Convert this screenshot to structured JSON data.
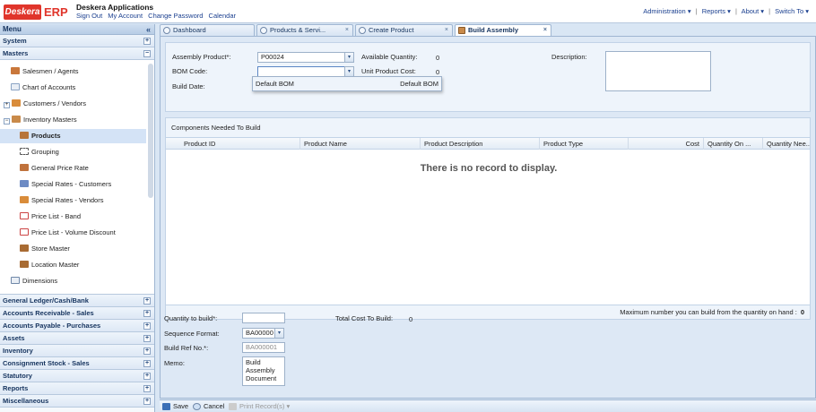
{
  "header": {
    "logo_text": "Deskera",
    "logo_erp": "ERP",
    "app_title": "Deskera Applications",
    "links": [
      "Sign Out",
      "My Account",
      "Change Password",
      "Calendar"
    ],
    "right_menu": [
      "Administration",
      "Reports",
      "About",
      "Switch To"
    ],
    "caret": "▾",
    "separator": "|"
  },
  "sidebar": {
    "title": "Menu",
    "collapse_glyph": "«",
    "top_sections": [
      {
        "label": "System",
        "state": "+"
      },
      {
        "label": "Masters",
        "state": "−"
      }
    ],
    "tree_items": [
      {
        "label": "Salesmen / Agents",
        "icon": "people-icon"
      },
      {
        "label": "Chart of Accounts",
        "icon": "chart-icon"
      },
      {
        "label": "Customers / Vendors",
        "icon": "people-icon",
        "expander": "+"
      },
      {
        "label": "Inventory Masters",
        "icon": "folder-icon",
        "expander": "−"
      },
      {
        "label": "Products",
        "icon": "box-icon",
        "selected": true
      },
      {
        "label": "Grouping",
        "icon": "grouping-icon"
      },
      {
        "label": "General Price Rate",
        "icon": "box-icon"
      },
      {
        "label": "Special Rates - Customers",
        "icon": "people-icon"
      },
      {
        "label": "Special Rates - Vendors",
        "icon": "people-icon"
      },
      {
        "label": "Price List - Band",
        "icon": "pricelist-icon"
      },
      {
        "label": "Price List - Volume Discount",
        "icon": "pricelist-icon"
      },
      {
        "label": "Store Master",
        "icon": "store-icon"
      },
      {
        "label": "Location Master",
        "icon": "store-icon"
      },
      {
        "label": "Dimensions",
        "icon": "dimensions-icon"
      }
    ],
    "bottom_sections": [
      "General Ledger/Cash/Bank",
      "Accounts Receivable - Sales",
      "Accounts Payable - Purchases",
      "Assets",
      "Inventory",
      "Consignment Stock - Sales",
      "Statutory",
      "Reports",
      "Miscellaneous"
    ],
    "expand_glyph": "+"
  },
  "tabs": [
    {
      "label": "Dashboard",
      "closable": false
    },
    {
      "label": "Products & Servi...",
      "closable": true
    },
    {
      "label": "Create Product",
      "closable": true
    },
    {
      "label": "Build Assembly",
      "closable": true,
      "active": true
    }
  ],
  "close_glyph": "×",
  "form": {
    "assembly_product_label": "Assembly Product*:",
    "assembly_product_value": "P00024",
    "bom_code_label": "BOM Code:",
    "bom_code_value": "",
    "build_date_label": "Build Date:",
    "available_quantity_label": "Available Quantity:",
    "available_quantity_value": "0",
    "unit_product_cost_label": "Unit Product Cost:",
    "unit_product_cost_value": "0",
    "description_label": "Description:",
    "dropdown_glyph": "▾",
    "bom_dropdown_option": {
      "left": "Default BOM",
      "right": "Default BOM"
    }
  },
  "grid": {
    "title": "Components Needed To Build",
    "columns": [
      "Product ID",
      "Product Name",
      "Product Description",
      "Product Type",
      "Cost",
      "Quantity On ...",
      "Quantity Nee..."
    ],
    "empty_text": "There is no record to display.",
    "footer_text": "Maximum number you can build from the quantity on hand :",
    "footer_value": "0"
  },
  "bottom_form": {
    "qty_label": "Quantity to build*:",
    "qty_value": "",
    "total_cost_label": "Total Cost To Build:",
    "total_cost_value": "0",
    "seq_label": "Sequence Format:",
    "seq_value": "BA00000",
    "ref_label": "Build Ref No.*:",
    "ref_value": "BA000001",
    "memo_label": "Memo:",
    "memo_value": "Build\nAssembly\nDocument"
  },
  "toolbar": {
    "save": "Save",
    "cancel": "Cancel",
    "print": "Print Record(s)"
  }
}
